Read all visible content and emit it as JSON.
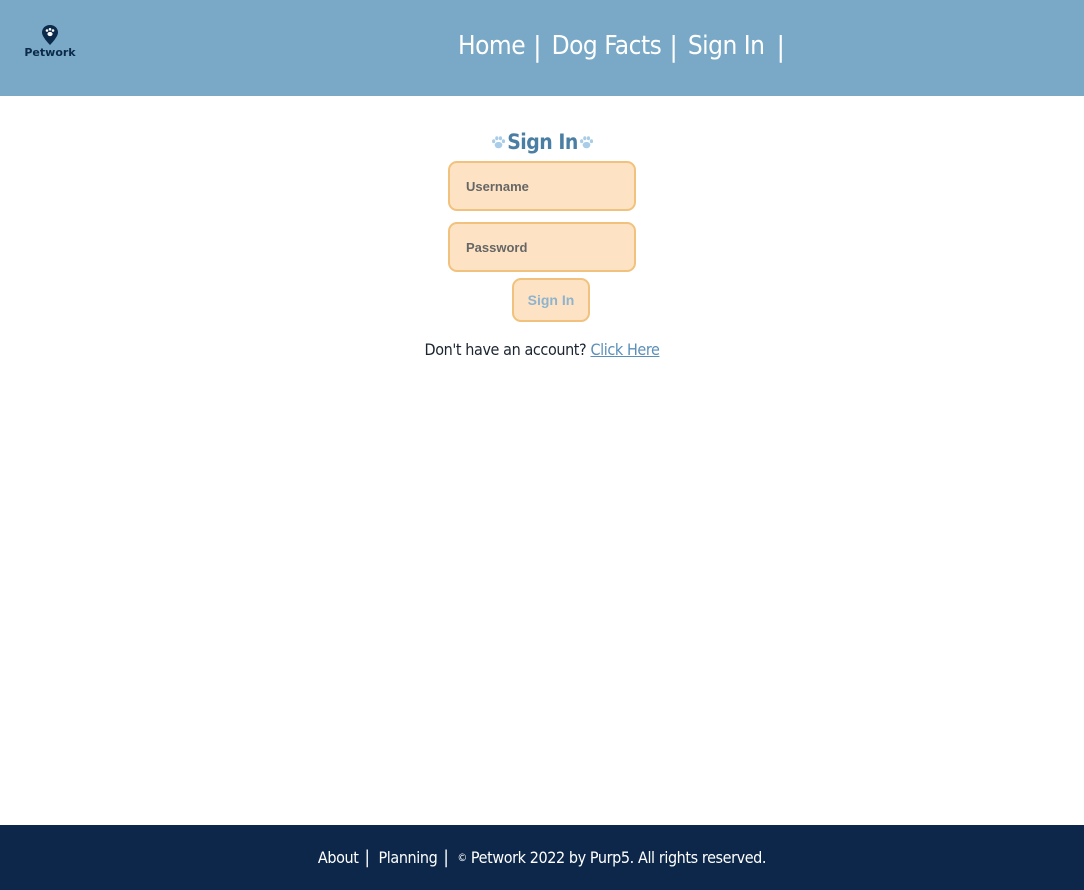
{
  "header": {
    "logo_text": "Petwork",
    "nav": [
      {
        "label": "Home"
      },
      {
        "label": "Dog Facts"
      },
      {
        "label": "Sign In"
      }
    ],
    "separator": "|"
  },
  "signin": {
    "title": "Sign In",
    "username_placeholder": "Username",
    "password_placeholder": "Password",
    "submit_label": "Sign In",
    "signup_prompt": "Don't have an account?",
    "signup_link": "Click Here"
  },
  "footer": {
    "links": [
      {
        "label": "About"
      },
      {
        "label": "Planning"
      }
    ],
    "separator": "|",
    "copyright_symbol": "©",
    "copyright_text": "Petwork 2022 by Purp5. All rights reserved."
  },
  "colors": {
    "header_bg": "#79a9c7",
    "footer_bg": "#0c274a",
    "field_bg": "#fde3c3",
    "field_border": "#f1c27d",
    "accent": "#4a7fa3",
    "link": "#5b8fb8"
  },
  "icons": {
    "logo": "paw-pin-icon",
    "title_decoration": "paw-print-icon"
  }
}
